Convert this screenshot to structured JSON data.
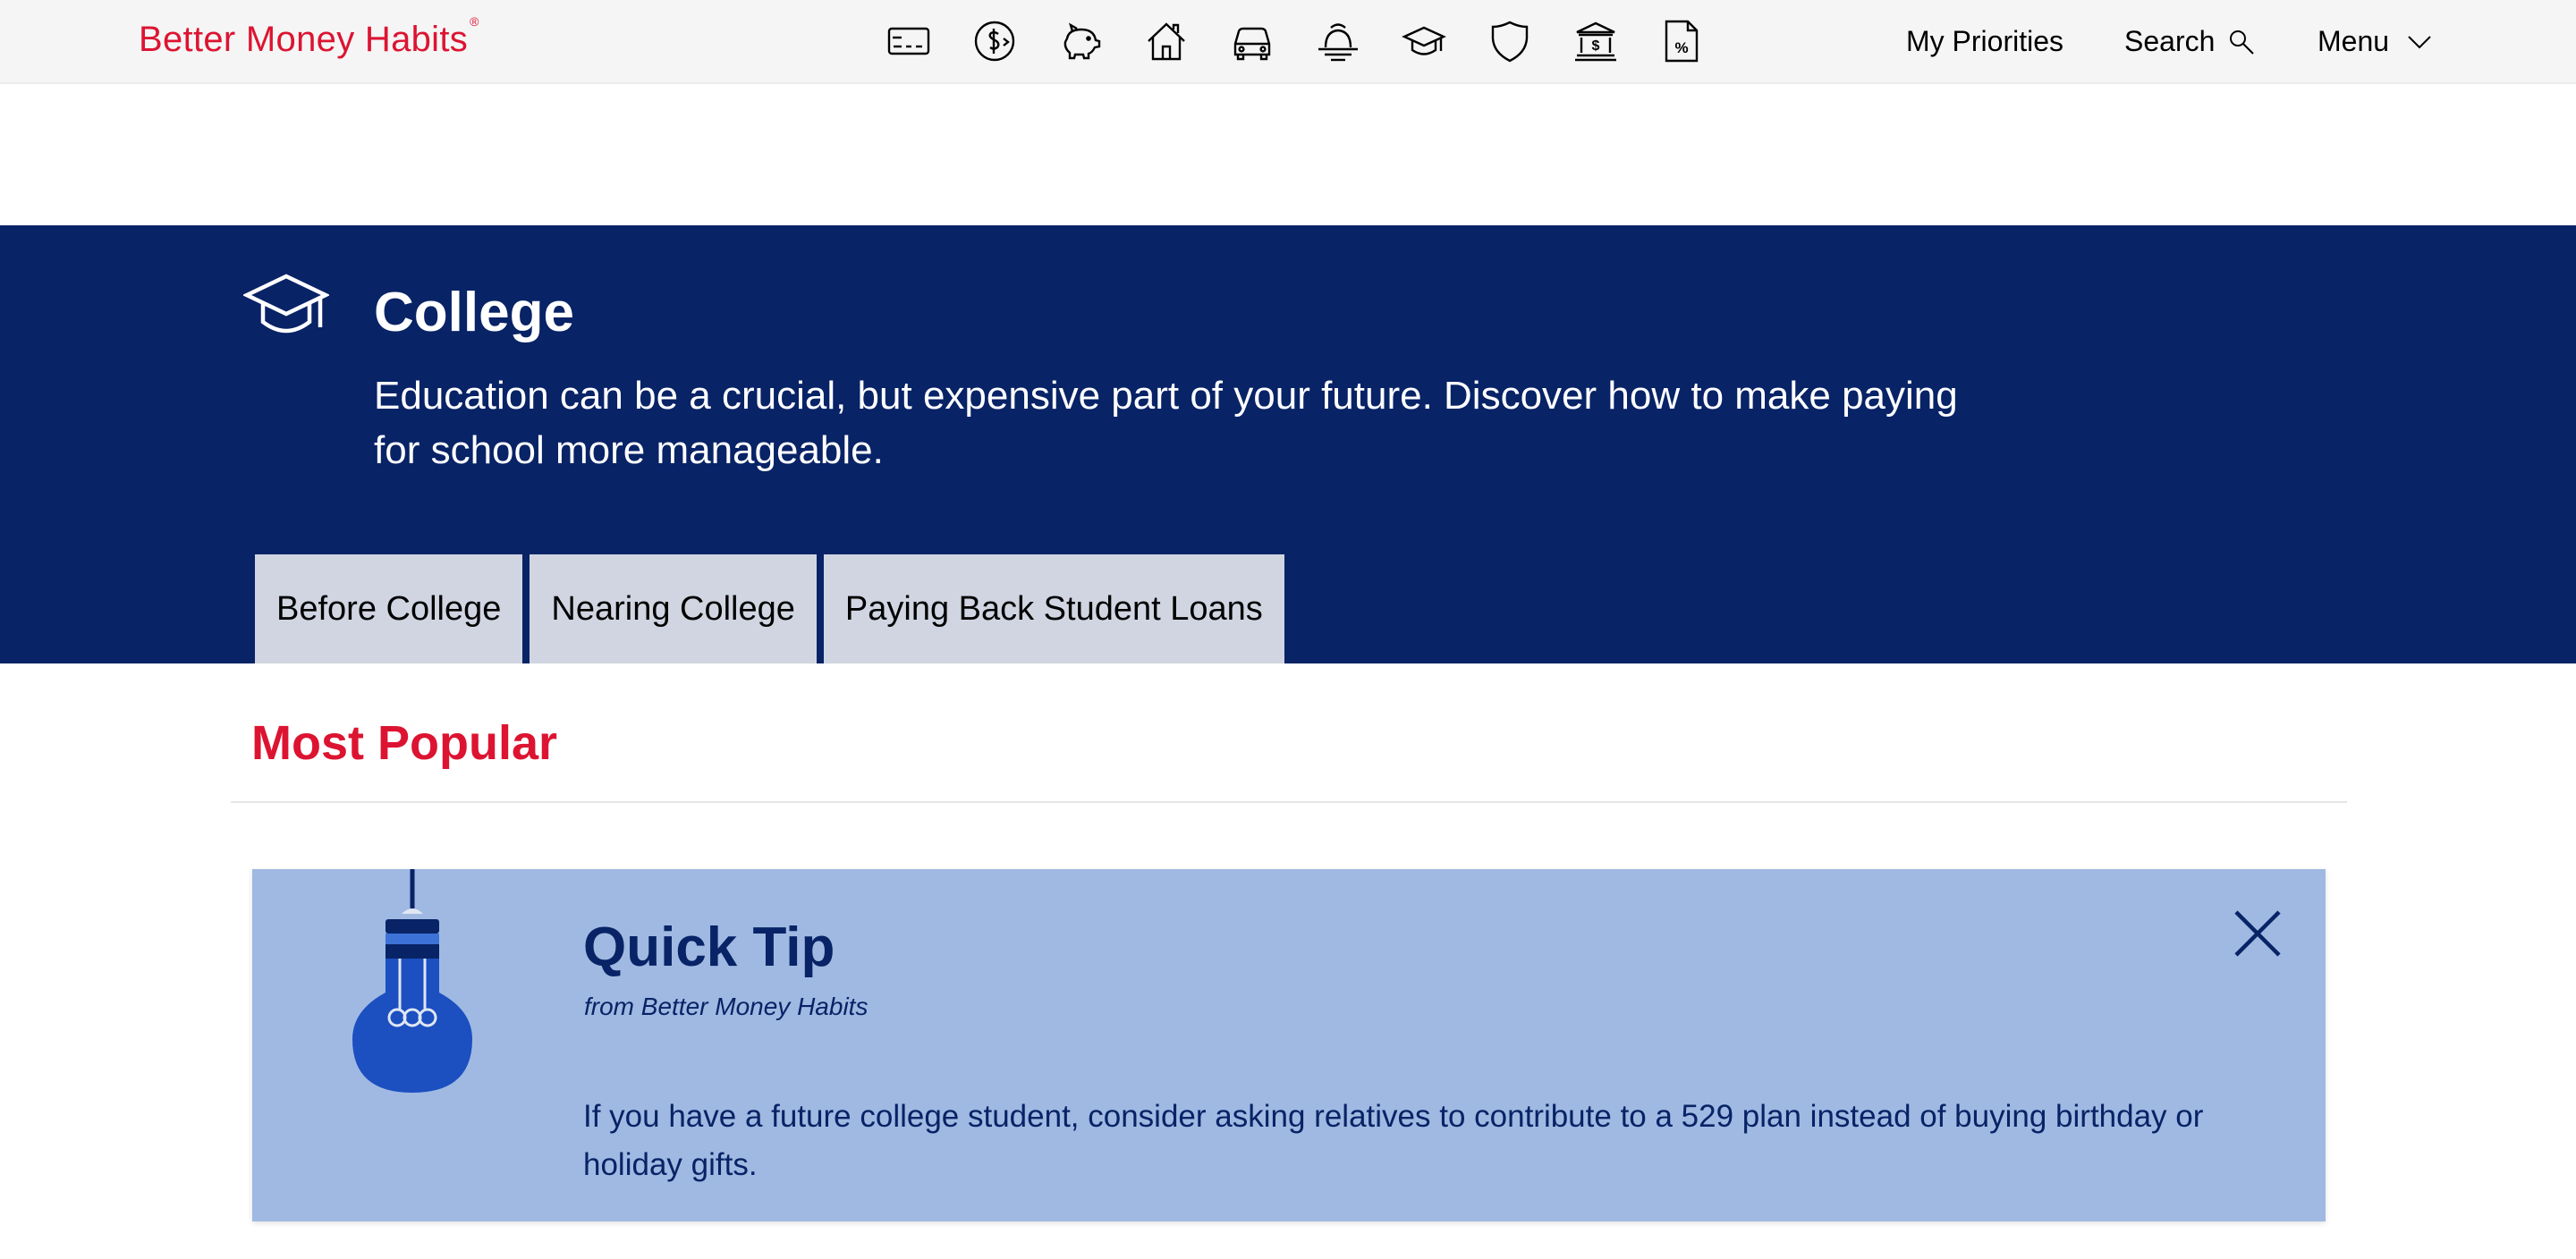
{
  "header": {
    "logo_text": "Better Money Habits",
    "logo_mark": "®",
    "nav_icons": [
      "credit-card-icon",
      "dollar-exchange-icon",
      "piggy-bank-icon",
      "house-icon",
      "car-icon",
      "sunset-retirement-icon",
      "graduation-cap-icon",
      "shield-icon",
      "bank-icon",
      "percent-document-icon"
    ],
    "my_priorities": "My Priorities",
    "search_label": "Search",
    "menu_label": "Menu"
  },
  "hero": {
    "title": "College",
    "description": "Education can be a crucial, but expensive part of your future. Discover how to make paying for school more manageable.",
    "tabs": [
      {
        "label": "Before College"
      },
      {
        "label": "Nearing College"
      },
      {
        "label": "Paying Back Student Loans"
      }
    ]
  },
  "most_popular": {
    "title": "Most Popular"
  },
  "quick_tip": {
    "title": "Quick Tip",
    "source": "from Better Money Habits",
    "text": "If you have a future college student, consider asking relatives to contribute to a 529 plan instead of buying birthday or holiday gifts."
  },
  "colors": {
    "brand_red": "#dc1431",
    "hero_navy": "#082366",
    "tab_gray": "#d0d5e1",
    "tip_blue": "#9fb9e2",
    "bulb_blue": "#1c4fc0"
  }
}
